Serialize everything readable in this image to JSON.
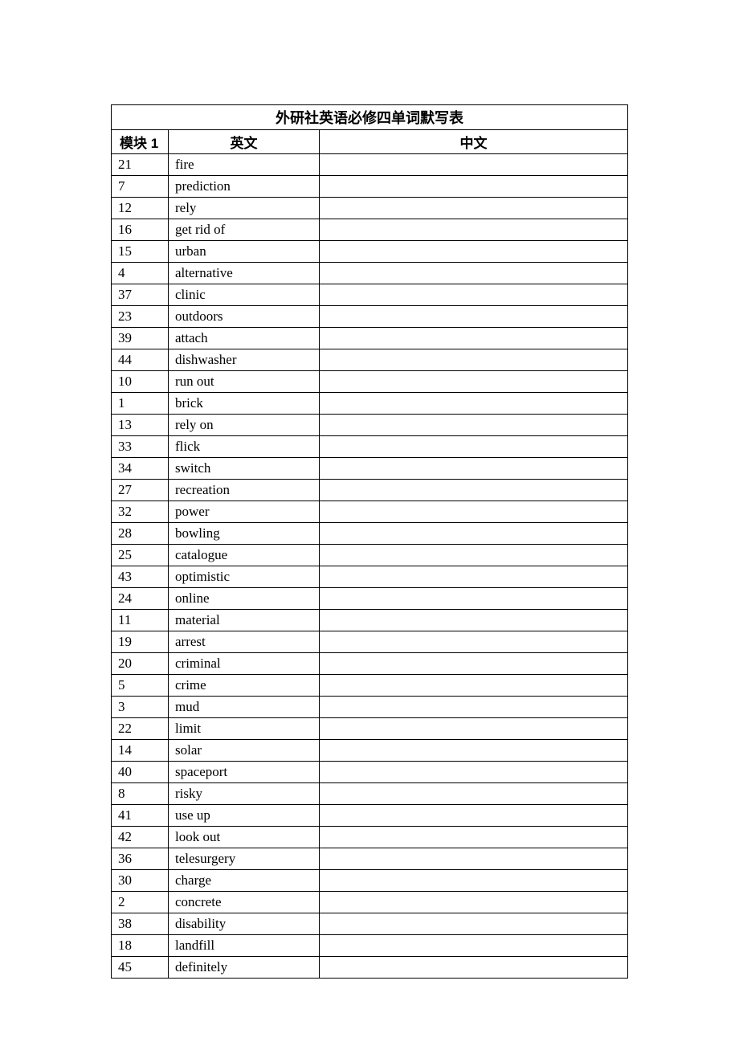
{
  "title": "外研社英语必修四单词默写表",
  "headers": {
    "module": "模块 1",
    "english": "英文",
    "chinese": "中文"
  },
  "rows": [
    {
      "num": "21",
      "eng": "fire",
      "chn": ""
    },
    {
      "num": "7",
      "eng": "prediction",
      "chn": ""
    },
    {
      "num": "12",
      "eng": "rely",
      "chn": ""
    },
    {
      "num": "16",
      "eng": "get rid of",
      "chn": ""
    },
    {
      "num": "15",
      "eng": "urban",
      "chn": ""
    },
    {
      "num": "4",
      "eng": "alternative",
      "chn": ""
    },
    {
      "num": "37",
      "eng": "clinic",
      "chn": ""
    },
    {
      "num": "23",
      "eng": "outdoors",
      "chn": ""
    },
    {
      "num": "39",
      "eng": "attach",
      "chn": ""
    },
    {
      "num": "44",
      "eng": "dishwasher",
      "chn": ""
    },
    {
      "num": "10",
      "eng": "run out",
      "chn": ""
    },
    {
      "num": "1",
      "eng": "brick",
      "chn": ""
    },
    {
      "num": "13",
      "eng": "rely on",
      "chn": ""
    },
    {
      "num": "33",
      "eng": "flick",
      "chn": ""
    },
    {
      "num": "34",
      "eng": "switch",
      "chn": ""
    },
    {
      "num": "27",
      "eng": "recreation",
      "chn": ""
    },
    {
      "num": "32",
      "eng": "power",
      "chn": ""
    },
    {
      "num": "28",
      "eng": "bowling",
      "chn": ""
    },
    {
      "num": "25",
      "eng": "catalogue",
      "chn": ""
    },
    {
      "num": "43",
      "eng": "optimistic",
      "chn": ""
    },
    {
      "num": "24",
      "eng": "online",
      "chn": ""
    },
    {
      "num": "11",
      "eng": "material",
      "chn": ""
    },
    {
      "num": "19",
      "eng": "arrest",
      "chn": ""
    },
    {
      "num": "20",
      "eng": "criminal",
      "chn": ""
    },
    {
      "num": "5",
      "eng": "crime",
      "chn": ""
    },
    {
      "num": "3",
      "eng": "mud",
      "chn": ""
    },
    {
      "num": "22",
      "eng": "limit",
      "chn": ""
    },
    {
      "num": "14",
      "eng": "solar",
      "chn": ""
    },
    {
      "num": "40",
      "eng": "spaceport",
      "chn": ""
    },
    {
      "num": "8",
      "eng": "risky",
      "chn": ""
    },
    {
      "num": "41",
      "eng": "use up",
      "chn": ""
    },
    {
      "num": "42",
      "eng": "look out",
      "chn": ""
    },
    {
      "num": "36",
      "eng": "telesurgery",
      "chn": ""
    },
    {
      "num": "30",
      "eng": "charge",
      "chn": ""
    },
    {
      "num": "2",
      "eng": "concrete",
      "chn": ""
    },
    {
      "num": "38",
      "eng": "disability",
      "chn": ""
    },
    {
      "num": "18",
      "eng": "landfill",
      "chn": ""
    },
    {
      "num": "45",
      "eng": "definitely",
      "chn": ""
    }
  ]
}
